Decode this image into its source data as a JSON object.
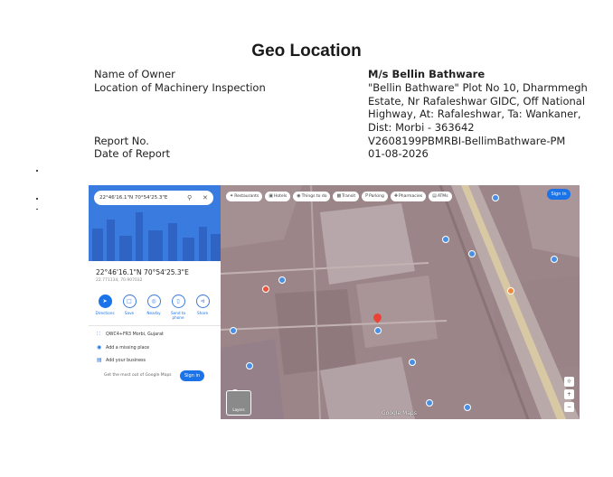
{
  "page": {
    "title": "Geo Location",
    "fields": [
      {
        "label": "Name of Owner",
        "value": "M/s Bellin Bathware"
      },
      {
        "label": "Location of Machinery Inspection",
        "value": "\"Bellin Bathware\" Plot No 10, Dharmmegh Estate, Nr Rafaleshwar GIDC, Off National Highway, At: Rafaleshwar, Ta: Wankaner, Dist: Morbi - 363642"
      },
      {
        "label": "Report No.",
        "value": "V2608199PBMRBI-BellimBathware-PM"
      },
      {
        "label": "Date of Report",
        "value": "01-08-2026"
      }
    ]
  },
  "maps": {
    "search_text": "22°46'16.1\"N 70°54'25.3\"E",
    "coordinates": "22°46'16.1\"N 70°54'25.3\"E",
    "coordinates_decimal": "22.771134, 70.907032",
    "actions": [
      {
        "label": "Directions",
        "icon": "directions-icon"
      },
      {
        "label": "Save",
        "icon": "bookmark-icon"
      },
      {
        "label": "Nearby",
        "icon": "nearby-icon"
      },
      {
        "label": "Send to phone",
        "icon": "phone-icon"
      },
      {
        "label": "Share",
        "icon": "share-icon"
      }
    ],
    "plus_code": "QWC4+FR3 Morbi, Gujarat",
    "add_missing_place": "Add a missing place",
    "add_business": "Add your business",
    "promo": "Get the most out of Google Maps",
    "signin_label": "Sign in",
    "chips": [
      {
        "label": "Restaurants",
        "icon": "fork-icon"
      },
      {
        "label": "Hotels",
        "icon": "bed-icon"
      },
      {
        "label": "Things to do",
        "icon": "camera-icon"
      },
      {
        "label": "Transit",
        "icon": "train-icon"
      },
      {
        "label": "Parking",
        "icon": "parking-icon"
      },
      {
        "label": "Pharmacies",
        "icon": "pill-icon"
      },
      {
        "label": "ATMs",
        "icon": "atm-icon"
      }
    ],
    "layers_label": "Layers",
    "brand": "Google Maps"
  },
  "colors": {
    "maps_blue": "#1a73e8",
    "pin_red": "#ea4335",
    "satellite": "#9e8a8c"
  }
}
